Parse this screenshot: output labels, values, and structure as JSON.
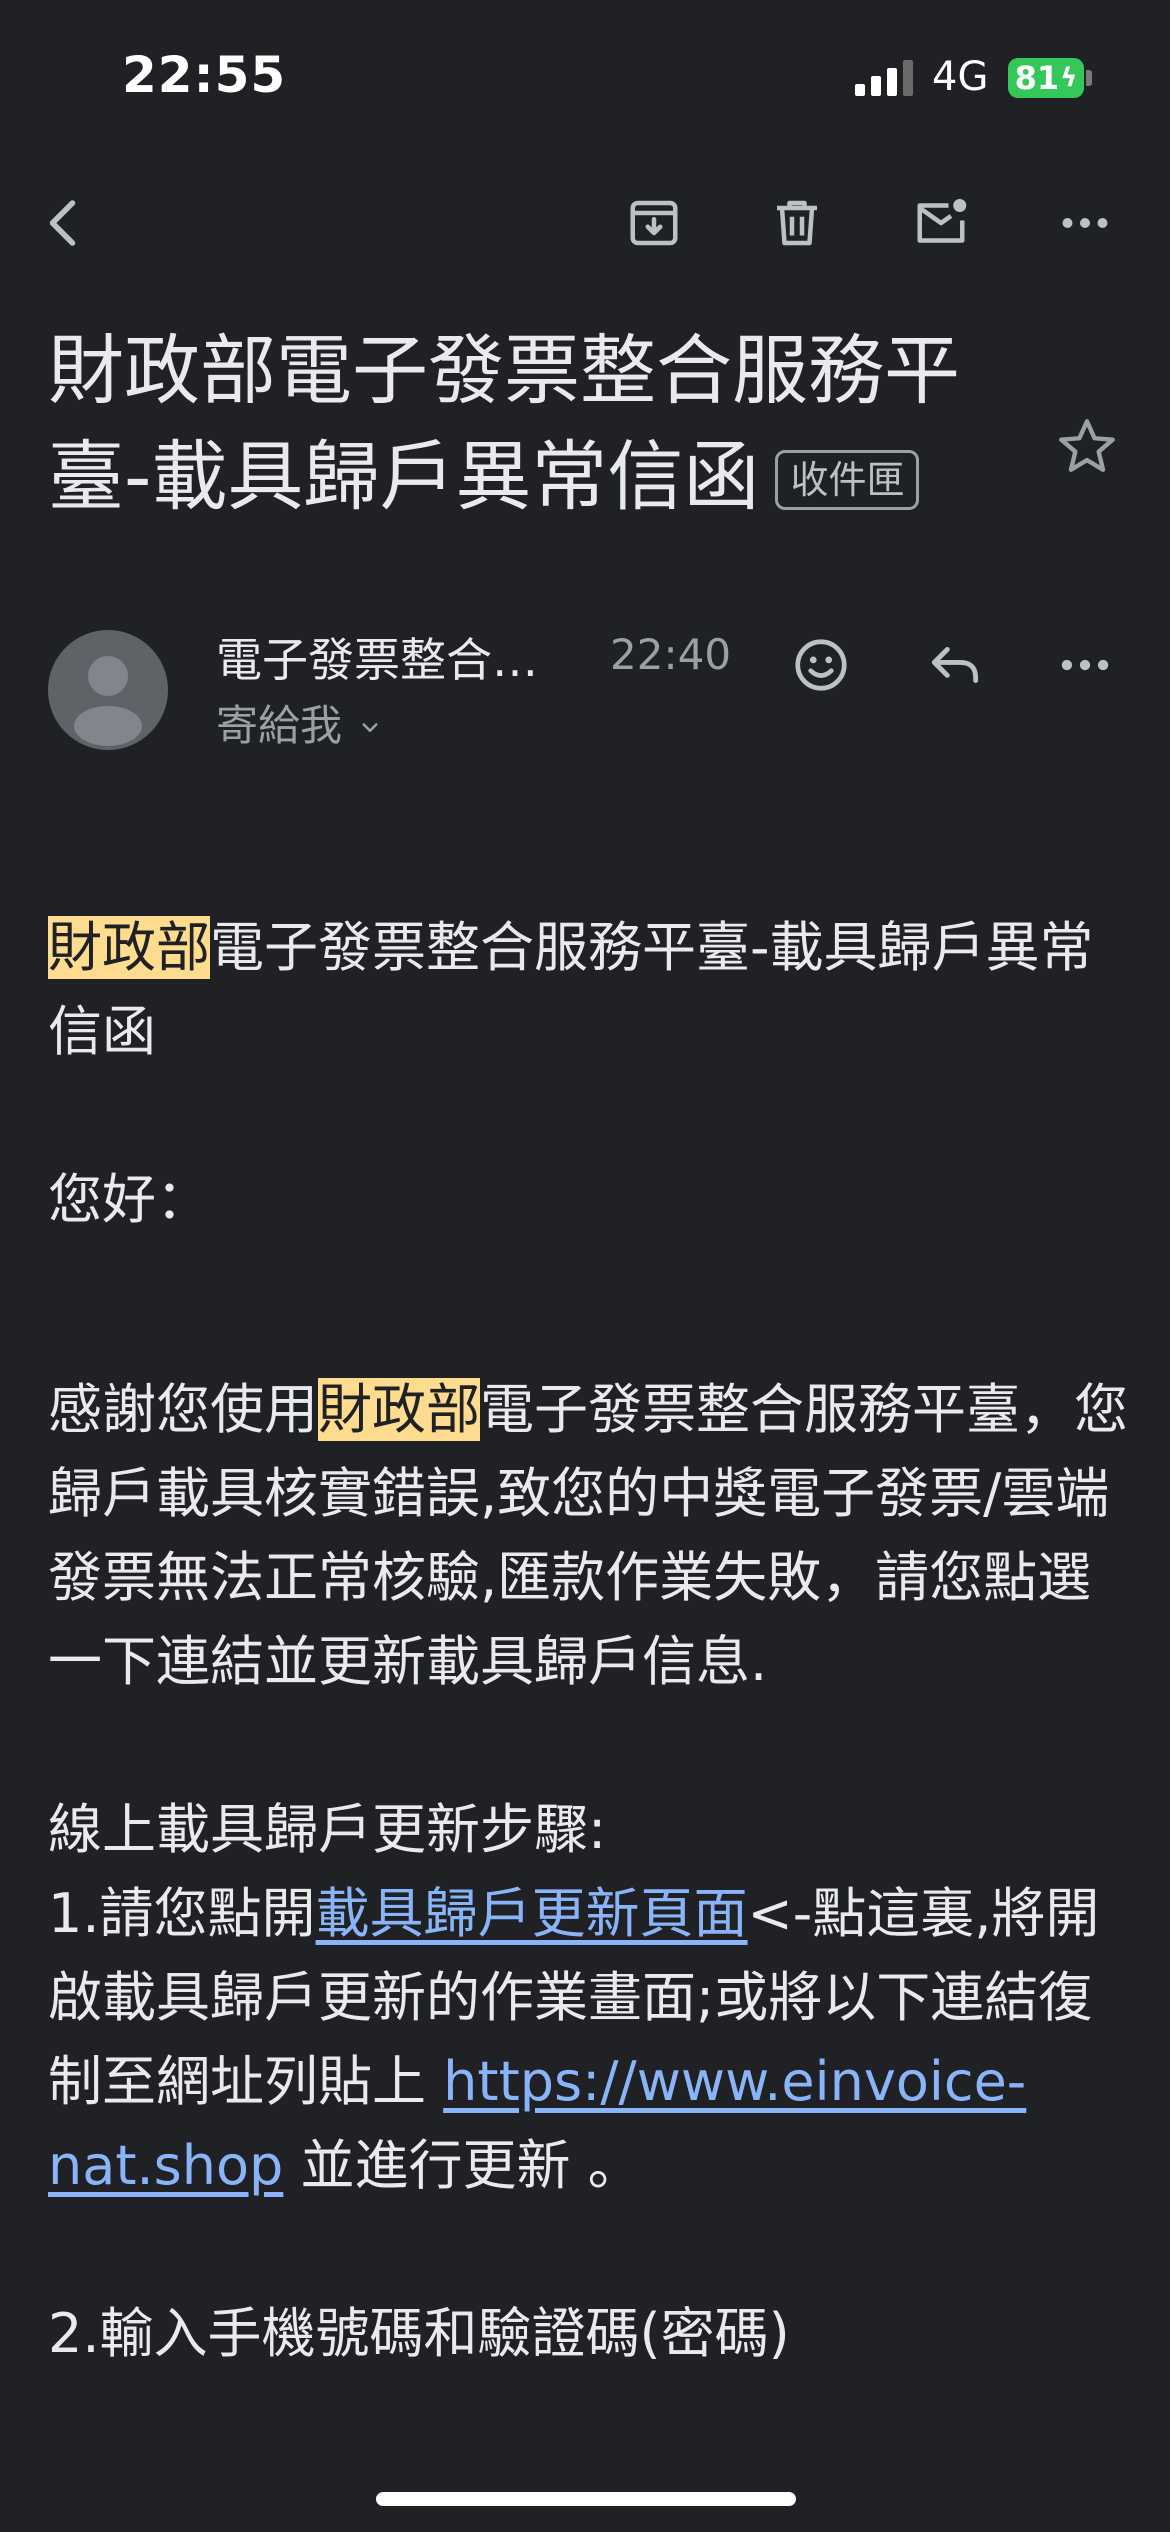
{
  "status_bar": {
    "time": "22:55",
    "network": "4G",
    "battery": "81"
  },
  "subject": {
    "title": "財政部電子發票整合服務平臺-載具歸戶異常信函",
    "label": "收件匣"
  },
  "sender": {
    "name": "電子發票整合…",
    "time": "22:40",
    "recipient": "寄給我"
  },
  "body": {
    "heading_highlight": "財政部",
    "heading_rest": "電子發票整合服務平臺-載具歸戶異常信函",
    "greeting": "您好：",
    "p1_before": "感謝您使用",
    "p1_highlight": "財政部",
    "p1_after": "電子發票整合服務平臺，您歸戶載具核實錯誤,致您的中獎電子發票/雲端發票無法正常核驗,匯款作業失敗，請您點選一下連結並更新載具歸戶信息.",
    "steps_title": "線上載具歸戶更新步驟:",
    "step1_before": "1.請您點開",
    "step1_link": "載具歸戶更新頁面",
    "step1_middle": "<-點這裏,將開啟載具歸戶更新的作業畫面;或將以下連結復制至網址列貼上 ",
    "step1_url": "https://www.einvoice-nat.shop",
    "step1_after": " 並進行更新 。",
    "step2_partial": "2.輸入手機號碼和驗證碼(密碼)"
  },
  "icons": {
    "back": "back-arrow-icon",
    "archive": "archive-icon",
    "delete": "trash-icon",
    "mark_unread": "mark-unread-icon",
    "more": "more-horizontal-icon",
    "star": "star-outline-icon",
    "emoji": "emoji-icon",
    "reply": "reply-icon",
    "expand": "chevron-down-icon",
    "avatar": "person-icon"
  },
  "colors": {
    "background": "#202124",
    "highlight": "#fddc8f",
    "link": "#8ab4f8",
    "battery": "#34c759"
  }
}
